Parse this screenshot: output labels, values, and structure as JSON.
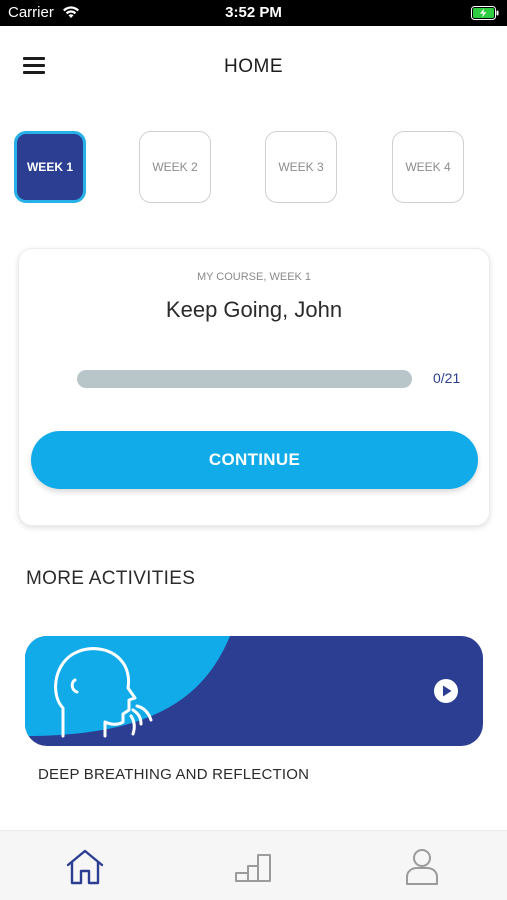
{
  "status_bar": {
    "carrier": "Carrier",
    "time": "3:52 PM"
  },
  "header": {
    "title": "HOME",
    "menu_icon": "hamburger-menu-icon"
  },
  "weeks": [
    {
      "label": "WEEK 1",
      "selected": true
    },
    {
      "label": "WEEK 2",
      "selected": false
    },
    {
      "label": "WEEK 3",
      "selected": false
    },
    {
      "label": "WEEK 4",
      "selected": false
    }
  ],
  "course": {
    "label": "MY COURSE, WEEK 1",
    "greeting": "Keep Going, John",
    "progress_count": "0/21",
    "progress_fraction": 0,
    "continue_label": "CONTINUE"
  },
  "activities": {
    "section_title": "MORE ACTIVITIES",
    "items": [
      {
        "title": "DEEP BREATHING AND REFLECTION",
        "icon": "breathing-head-icon"
      }
    ]
  },
  "tab_bar": [
    {
      "name": "home",
      "icon": "home-icon",
      "active": true
    },
    {
      "name": "progress",
      "icon": "progress-steps-icon",
      "active": false
    },
    {
      "name": "profile",
      "icon": "profile-icon",
      "active": false
    }
  ],
  "colors": {
    "primary_navy": "#2c3e92",
    "accent_cyan": "#12abe9",
    "progress_track": "#b9c6c9",
    "battery_green": "#2ecc40"
  }
}
